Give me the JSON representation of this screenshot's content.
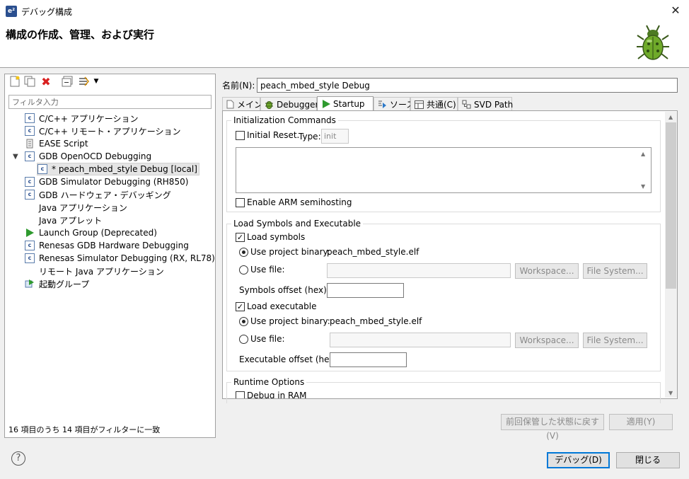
{
  "window": {
    "title": "デバッグ構成",
    "app_icon_text": "e²",
    "close_symbol": "✕"
  },
  "header": {
    "title": "構成の作成、管理、および実行",
    "icon": "bug-icon"
  },
  "sidebar": {
    "toolbar_icons": [
      "new-config-icon",
      "duplicate-icon",
      "delete-icon",
      "collapse-all-icon",
      "filter-icon"
    ],
    "filter_placeholder": "フィルタ入力",
    "items": [
      {
        "label": "C/C++ アプリケーション",
        "icon": "c-app-icon"
      },
      {
        "label": "C/C++ リモート・アプリケーション",
        "icon": "c-app-icon"
      },
      {
        "label": "EASE Script",
        "icon": "script-icon"
      },
      {
        "label": "GDB OpenOCD Debugging",
        "icon": "c-app-icon",
        "expanded": true
      },
      {
        "label": "* peach_mbed_style Debug [local]",
        "icon": "c-app-icon",
        "selected": true
      },
      {
        "label": "GDB Simulator Debugging (RH850)",
        "icon": "c-app-icon"
      },
      {
        "label": "GDB ハードウェア・デバッギング",
        "icon": "c-app-icon"
      },
      {
        "label": "Java アプリケーション",
        "icon": ""
      },
      {
        "label": "Java アプレット",
        "icon": ""
      },
      {
        "label": "Launch Group (Deprecated)",
        "icon": "launch-icon"
      },
      {
        "label": "Renesas GDB Hardware Debugging",
        "icon": "c-app-icon"
      },
      {
        "label": "Renesas Simulator Debugging (RX, RL78)",
        "icon": "c-app-icon"
      },
      {
        "label": "リモート Java アプリケーション",
        "icon": ""
      },
      {
        "label": "起動グループ",
        "icon": "group-launch-icon"
      }
    ],
    "status": "16 項目のうち 14 項目がフィルターに一致"
  },
  "config": {
    "name_label": "名前(N):",
    "name_value": "peach_mbed_style Debug",
    "tabs": [
      {
        "label": "メイン",
        "icon": "main-icon"
      },
      {
        "label": "Debugger",
        "icon": "debugger-icon"
      },
      {
        "label": "Startup",
        "icon": "startup-icon",
        "active": true
      },
      {
        "label": "ソース",
        "icon": "source-icon"
      },
      {
        "label": "共通(C)",
        "icon": "common-icon"
      },
      {
        "label": "SVD Path",
        "icon": "svd-icon"
      }
    ]
  },
  "startup": {
    "init_title": "Initialization Commands",
    "initial_reset_label": "Initial Reset.",
    "initial_reset_checked": false,
    "type_label": "Type:",
    "type_value": "init",
    "init_commands_value": "",
    "enable_semihosting_label": "Enable ARM semihosting",
    "enable_semihosting_checked": false,
    "load_title": "Load Symbols and Executable",
    "load_symbols_label": "Load symbols",
    "load_symbols_checked": true,
    "use_project_binary_label": "Use project binary:",
    "symbols_binary": "peach_mbed_style.elf",
    "use_file_label": "Use file:",
    "workspace_btn": "Workspace...",
    "filesystem_btn": "File System...",
    "symbols_offset_label": "Symbols offset (hex):",
    "symbols_offset_value": "",
    "load_executable_label": "Load executable",
    "load_executable_checked": true,
    "executable_binary": "peach_mbed_style.elf",
    "executable_offset_label": "Executable offset (hex):",
    "executable_offset_value": "",
    "runtime_title": "Runtime Options",
    "debug_in_ram_label": "Debug in RAM"
  },
  "actions": {
    "revert_label": "前回保管した状態に戻す(V)",
    "apply_label": "適用(Y)",
    "debug_label": "デバッグ(D)",
    "close_label": "閉じる",
    "help_symbol": "?"
  }
}
